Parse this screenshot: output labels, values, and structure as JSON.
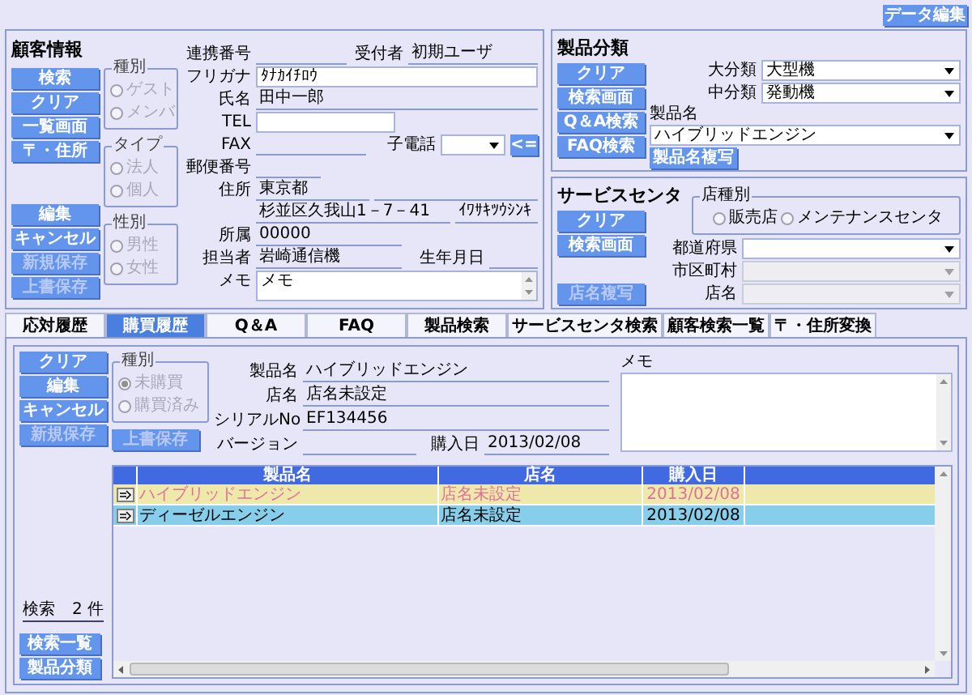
{
  "data_edit_button": {
    "label": "データ編集",
    "disabled": false
  },
  "customer": {
    "title": "顧客情報",
    "buttons_top": [
      {
        "label": "検索",
        "disabled": false
      },
      {
        "label": "クリア",
        "disabled": false
      },
      {
        "label": "一覧画面",
        "disabled": false
      },
      {
        "label": "〒・住所",
        "disabled": false
      }
    ],
    "buttons_bottom": [
      {
        "label": "編集",
        "disabled": false
      },
      {
        "label": "キャンセル",
        "disabled": false
      },
      {
        "label": "新規保存",
        "disabled": true
      },
      {
        "label": "上書保存",
        "disabled": true
      }
    ],
    "groups": [
      {
        "legend": "種別",
        "disabled": true,
        "options": [
          {
            "label": "ゲスト",
            "selected": false
          },
          {
            "label": "メンバ",
            "selected": false
          }
        ]
      },
      {
        "legend": "タイプ",
        "disabled": true,
        "options": [
          {
            "label": "法人",
            "selected": false
          },
          {
            "label": "個人",
            "selected": false
          }
        ]
      },
      {
        "legend": "性別",
        "disabled": true,
        "options": [
          {
            "label": "男性",
            "selected": false
          },
          {
            "label": "女性",
            "selected": false
          }
        ]
      }
    ],
    "link_no": {
      "label": "連携番号"
    },
    "receiver": {
      "label": "受付者",
      "value": "初期ユーザ"
    },
    "furigana": {
      "label": "フリガナ",
      "value": "ﾀﾅｶｲﾁﾛｳ"
    },
    "name": {
      "label": "氏名",
      "value": "田中一郎"
    },
    "tel": {
      "label": "TEL"
    },
    "fax": {
      "label": "FAX"
    },
    "child_phone": {
      "label": "子電話"
    },
    "copy_button": {
      "label": "<=",
      "disabled": false
    },
    "postal": {
      "label": "郵便番号"
    },
    "address": {
      "label": "住所",
      "prefecture": "東京都",
      "street": "杉並区久我山1－7－41",
      "kana": "ｲﾜｻｷﾂｳｼﾝｷ"
    },
    "affiliation": {
      "label": "所属",
      "value": "00000"
    },
    "staff": {
      "label": "担当者",
      "value": "岩崎通信機"
    },
    "birthday": {
      "label": "生年月日"
    },
    "memo": {
      "label": "メモ",
      "value": "メモ"
    }
  },
  "product_class": {
    "title": "製品分類",
    "buttons": [
      {
        "label": "クリア",
        "disabled": false
      },
      {
        "label": "検索画面",
        "disabled": false
      },
      {
        "label": "Q＆A検索",
        "disabled": false
      },
      {
        "label": "FAQ検索",
        "disabled": false
      }
    ],
    "major": {
      "label": "大分類",
      "value": "大型機",
      "disabled": false
    },
    "minor": {
      "label": "中分類",
      "value": "発動機",
      "disabled": false
    },
    "product": {
      "label": "製品名",
      "value": "ハイブリッドエンジン",
      "disabled": false
    },
    "copy_button": {
      "label": "製品名複写",
      "disabled": false
    }
  },
  "service_center": {
    "title": "サービスセンタ",
    "buttons": [
      {
        "label": "クリア",
        "disabled": false
      },
      {
        "label": "検索画面",
        "disabled": false
      }
    ],
    "copy_button": {
      "label": "店名複写",
      "disabled": true
    },
    "group": {
      "legend": "店種別",
      "disabled": false,
      "options": [
        {
          "label": "販売店",
          "selected": false
        },
        {
          "label": "メンテナンスセンタ",
          "selected": false
        }
      ]
    },
    "selects": [
      {
        "label": "都道府県",
        "disabled": false
      },
      {
        "label": "市区町村",
        "disabled": true
      },
      {
        "label": "店名",
        "disabled": true
      }
    ]
  },
  "tabs": [
    {
      "label": "応対履歴",
      "selected": false
    },
    {
      "label": "購買履歴",
      "selected": true
    },
    {
      "label": "Q＆A",
      "selected": false
    },
    {
      "label": "FAQ",
      "selected": false
    },
    {
      "label": "製品検索",
      "selected": false
    },
    {
      "label": "サービスセンタ検索",
      "selected": false
    },
    {
      "label": "顧客検索一覧",
      "selected": false
    },
    {
      "label": "〒・住所変換",
      "selected": false
    }
  ],
  "purchase": {
    "buttons": [
      {
        "label": "クリア",
        "disabled": false
      },
      {
        "label": "編集",
        "disabled": false
      },
      {
        "label": "キャンセル",
        "disabled": false
      },
      {
        "label": "新規保存",
        "disabled": true
      }
    ],
    "group": {
      "legend": "種別",
      "disabled": true,
      "options": [
        {
          "label": "未購買",
          "selected": true
        },
        {
          "label": "購買済み",
          "selected": false
        }
      ]
    },
    "overwrite_button": {
      "label": "上書保存",
      "disabled": true
    },
    "product": {
      "label": "製品名",
      "value": "ハイブリッドエンジン"
    },
    "shop": {
      "label": "店名",
      "value": "店名未設定"
    },
    "serial": {
      "label": "シリアルNo",
      "value": "EF134456"
    },
    "version": {
      "label": "バージョン"
    },
    "date": {
      "label": "購入日",
      "value": "2013/02/08"
    },
    "memo": {
      "label": "メモ"
    },
    "search_label": "検索",
    "count": "2 件",
    "bottom_buttons": [
      {
        "label": "検索一覧",
        "disabled": false
      },
      {
        "label": "製品分類",
        "disabled": false
      }
    ],
    "table": {
      "columns": [
        "製品名",
        "店名",
        "購入日"
      ],
      "rows": [
        {
          "cells": [
            "ハイブリッドエンジン",
            "店名未設定",
            "2013/02/08"
          ],
          "selected": false
        },
        {
          "cells": [
            "ディーゼルエンジン",
            "店名未設定",
            "2013/02/08"
          ],
          "selected": true
        }
      ]
    }
  }
}
